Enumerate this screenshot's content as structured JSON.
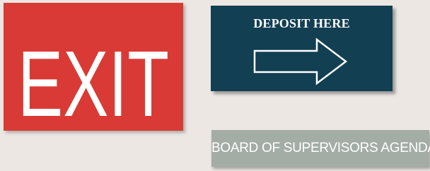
{
  "exit_sign": {
    "text": "EXIT",
    "background_color": "#d93a35",
    "text_color": "#ffffff"
  },
  "deposit_sign": {
    "title": "DEPOSIT HERE",
    "icon": "right-arrow-icon",
    "background_color": "#123f52",
    "text_color": "#ffffff"
  },
  "board_sign": {
    "text": "BOARD OF SUPERVISORS AGENDA",
    "background_color": "#a3ada6",
    "text_color": "#ffffff"
  },
  "page": {
    "background_color": "#ece7e3"
  }
}
